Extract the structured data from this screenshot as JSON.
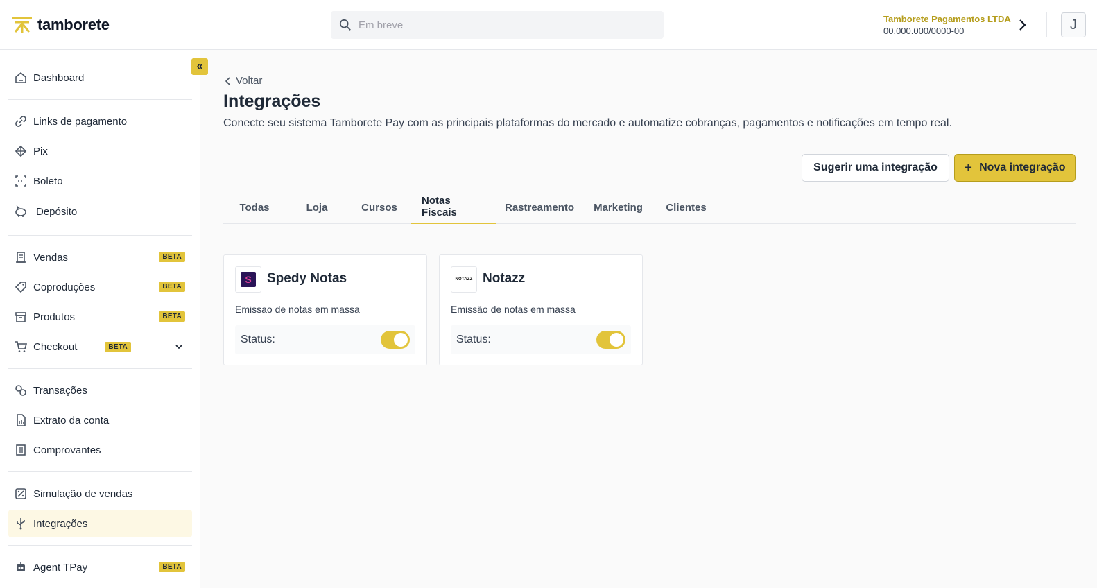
{
  "header": {
    "logo_text": "tamborete",
    "search_placeholder": "Em breve",
    "company_name": "Tamborete Pagamentos LTDA",
    "company_doc": "00.000.000/0000-00",
    "avatar_initial": "J"
  },
  "sidebar": {
    "collapse_label": "«",
    "items": [
      {
        "label": "Dashboard",
        "icon": "home-icon"
      },
      {
        "label": "Links de pagamento",
        "icon": "link-icon"
      },
      {
        "label": "Pix",
        "icon": "pix-icon"
      },
      {
        "label": "Boleto",
        "icon": "barcode-icon"
      },
      {
        "label": "Depósito",
        "icon": "piggy-bank-icon"
      },
      {
        "label": "Vendas",
        "icon": "receipt-icon",
        "badge": "BETA"
      },
      {
        "label": "Coproduções",
        "icon": "tag-icon",
        "badge": "BETA"
      },
      {
        "label": "Produtos",
        "icon": "archive-icon",
        "badge": "BETA"
      },
      {
        "label": "Checkout",
        "icon": "cart-icon",
        "badge": "BETA"
      },
      {
        "label": "Transações",
        "icon": "transactions-icon"
      },
      {
        "label": "Extrato da conta",
        "icon": "statement-icon"
      },
      {
        "label": "Comprovantes",
        "icon": "list-icon"
      },
      {
        "label": "Simulação de vendas",
        "icon": "percent-icon"
      },
      {
        "label": "Integrações",
        "icon": "usb-icon"
      },
      {
        "label": "Agent TPay",
        "icon": "robot-icon",
        "badge": "BETA"
      }
    ]
  },
  "main": {
    "back_label": "Voltar",
    "title": "Integrações",
    "subtitle": "Conecte seu sistema Tamborete Pay com as principais plataformas do mercado e automatize cobranças, pagamentos e notificações em tempo real.",
    "suggest_button": "Sugerir uma integração",
    "new_button": "Nova integração",
    "new_button_icon": "+",
    "tabs": [
      "Todas",
      "Loja",
      "Cursos",
      "Notas Fiscais",
      "Rastreamento",
      "Marketing",
      "Clientes"
    ],
    "active_tab": "Notas Fiscais",
    "cards": [
      {
        "name": "Spedy Notas",
        "description": "Emissao de notas em massa",
        "status_label": "Status:",
        "enabled": true,
        "logo_text": "S"
      },
      {
        "name": "Notazz",
        "description": "Emissão de notas em massa",
        "status_label": "Status:",
        "enabled": true,
        "logo_text": "NOTAZZ"
      }
    ]
  },
  "colors": {
    "accent": "#e2c43b",
    "accent_dark": "#b59d1c",
    "active_bg": "#fdf8e4"
  }
}
